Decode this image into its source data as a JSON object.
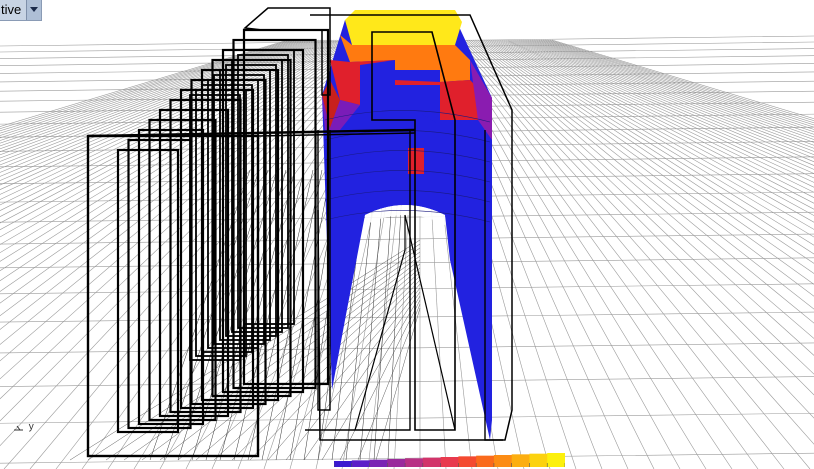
{
  "viewport": {
    "title": "tive",
    "menu_icon": "chevron-down-icon",
    "axis_label": "y",
    "background": "#ffffff",
    "grid_color": "#9a9a9a",
    "wire_color": "#000000"
  },
  "legend": {
    "colors": [
      "#3a1ad0",
      "#5a1ec8",
      "#7a24b4",
      "#9a2a9c",
      "#b83084",
      "#d2346a",
      "#e83a4e",
      "#f44a30",
      "#fa6a1c",
      "#fc8c14",
      "#fcae10",
      "#fcd20e",
      "#fcf00c"
    ]
  },
  "surface": {
    "colors": {
      "low": "#2222e0",
      "mid_low": "#7a1cb8",
      "mid": "#e0202c",
      "mid_high": "#ff7a10",
      "high": "#ffe81a"
    }
  }
}
